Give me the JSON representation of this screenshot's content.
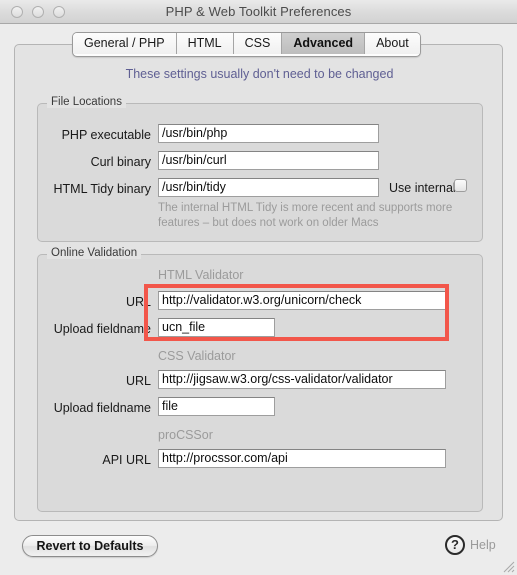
{
  "window": {
    "title": "PHP & Web Toolkit Preferences",
    "traffic_lights": [
      "close",
      "minimize",
      "zoom"
    ]
  },
  "tabs": [
    {
      "label": "General / PHP",
      "selected": false
    },
    {
      "label": "HTML",
      "selected": false
    },
    {
      "label": "CSS",
      "selected": false
    },
    {
      "label": "Advanced",
      "selected": true
    },
    {
      "label": "About",
      "selected": false
    }
  ],
  "notice": "These settings usually don't need to be changed",
  "file_locations": {
    "title": "File Locations",
    "php_executable": {
      "label": "PHP executable",
      "value": "/usr/bin/php"
    },
    "curl_binary": {
      "label": "Curl binary",
      "value": "/usr/bin/curl"
    },
    "html_tidy_binary": {
      "label": "HTML Tidy binary",
      "value": "/usr/bin/tidy"
    },
    "use_internal": {
      "label": "Use internal?",
      "checked": false
    },
    "tidy_hint_line1": "The internal HTML Tidy is more recent and supports more",
    "tidy_hint_line2": "features – but does not work on older Macs"
  },
  "online_validation": {
    "title": "Online Validation",
    "html_validator": {
      "subhead": "HTML Validator",
      "url": {
        "label": "URL",
        "value": "http://validator.w3.org/unicorn/check"
      },
      "upload_fieldname": {
        "label": "Upload fieldname",
        "value": "ucn_file"
      }
    },
    "css_validator": {
      "subhead": "CSS Validator",
      "url": {
        "label": "URL",
        "value": "http://jigsaw.w3.org/css-validator/validator"
      },
      "upload_fieldname": {
        "label": "Upload fieldname",
        "value": "file"
      }
    },
    "procssor": {
      "subhead": "proCSSor",
      "api_url": {
        "label": "API URL",
        "value": "http://procssor.com/api"
      }
    }
  },
  "footer": {
    "revert_label": "Revert to Defaults",
    "help_glyph": "?",
    "help_label": "Help"
  },
  "annotation": {
    "type": "highlight-rectangle",
    "color": "#f2564a",
    "targets": [
      "html-validator-url-field",
      "html-validator-upload-fieldname-field"
    ]
  }
}
